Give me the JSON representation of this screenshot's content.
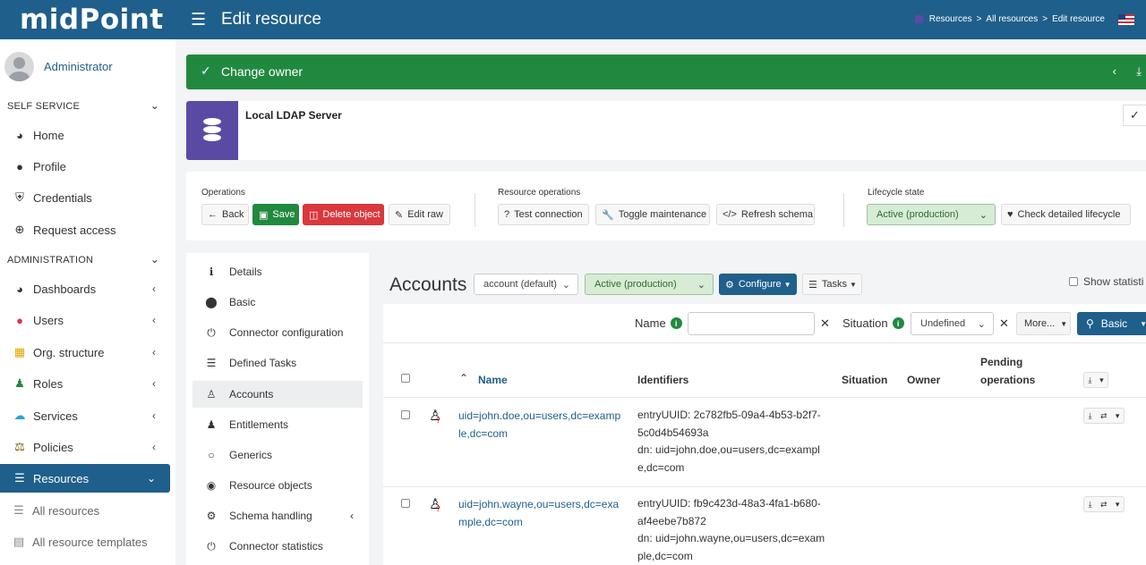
{
  "app": {
    "logo": "midPoint",
    "page_title": "Edit resource",
    "breadcrumb": [
      "Resources",
      "All resources",
      "Edit resource"
    ],
    "breadcrumb_sep": ">"
  },
  "sidebar": {
    "user_name": "Administrator",
    "sections": [
      {
        "title": "SELF SERVICE"
      },
      {
        "title": "ADMINISTRATION"
      }
    ],
    "self_service": [
      {
        "label": "Home",
        "icon": "dashboard-icon"
      },
      {
        "label": "Profile",
        "icon": "user-icon"
      },
      {
        "label": "Credentials",
        "icon": "shield-icon"
      },
      {
        "label": "Request access",
        "icon": "plus-circle-icon"
      }
    ],
    "administration": [
      {
        "label": "Dashboards",
        "icon": "dashboard-icon"
      },
      {
        "label": "Users",
        "icon": "user-icon"
      },
      {
        "label": "Org. structure",
        "icon": "building-icon"
      },
      {
        "label": "Roles",
        "icon": "role-icon"
      },
      {
        "label": "Services",
        "icon": "cloud-icon"
      },
      {
        "label": "Policies",
        "icon": "balance-icon"
      },
      {
        "label": "Resources",
        "icon": "database-icon"
      },
      {
        "label": "All resources",
        "icon": "database-icon"
      },
      {
        "label": "All resource templates",
        "icon": "file-icon"
      }
    ]
  },
  "alert": {
    "text": "Change owner"
  },
  "resource": {
    "name": "Local LDAP Server"
  },
  "operations": {
    "label": "Operations",
    "back": "Back",
    "save": "Save",
    "delete": "Delete object",
    "edit_raw": "Edit raw"
  },
  "resource_operations": {
    "label": "Resource operations",
    "test_connection": "Test connection",
    "toggle_maintenance": "Toggle maintenance",
    "refresh_schema": "Refresh schema"
  },
  "lifecycle": {
    "label": "Lifecycle state",
    "value": "Active (production)",
    "check_detailed": "Check detailed lifecycle"
  },
  "resource_menu": [
    {
      "label": "Details",
      "icon": "info-icon"
    },
    {
      "label": "Basic",
      "icon": "circle-icon"
    },
    {
      "label": "Connector configuration",
      "icon": "plug-icon"
    },
    {
      "label": "Defined Tasks",
      "icon": "tasks-icon"
    },
    {
      "label": "Accounts",
      "icon": "person-icon"
    },
    {
      "label": "Entitlements",
      "icon": "users-icon"
    },
    {
      "label": "Generics",
      "icon": "circle-outline-icon"
    },
    {
      "label": "Resource objects",
      "icon": "eye-icon"
    },
    {
      "label": "Schema handling",
      "icon": "cogs-icon"
    },
    {
      "label": "Connector statistics",
      "icon": "plug-icon"
    }
  ],
  "accounts": {
    "title": "Accounts",
    "object_type": "account (default)",
    "lifecycle": "Active (production)",
    "configure": "Configure",
    "tasks": "Tasks",
    "show_statistics": "Show statisti",
    "search": {
      "name_label": "Name",
      "name_value": "",
      "situation_label": "Situation",
      "situation_value": "Undefined",
      "more": "More...",
      "basic": "Basic"
    },
    "columns": {
      "name": "Name",
      "identifiers": "Identifiers",
      "situation": "Situation",
      "owner": "Owner",
      "pending_1": "Pending",
      "pending_2": "operations"
    },
    "rows": [
      {
        "name": "uid=john.doe,ou=users,dc=example,dc=com",
        "identifiers_1": "entryUUID: 2c782fb5-09a4-4b53-b2f7-5c0d4b54693a",
        "identifiers_2": "dn: uid=john.doe,ou=users,dc=example,dc=com"
      },
      {
        "name": "uid=john.wayne,ou=users,dc=example,dc=com",
        "identifiers_1": "entryUUID: fb9c423d-48a3-4fa1-b680-af4eebe7b872",
        "identifiers_2": "dn: uid=john.wayne,ou=users,dc=example,dc=com"
      }
    ]
  }
}
